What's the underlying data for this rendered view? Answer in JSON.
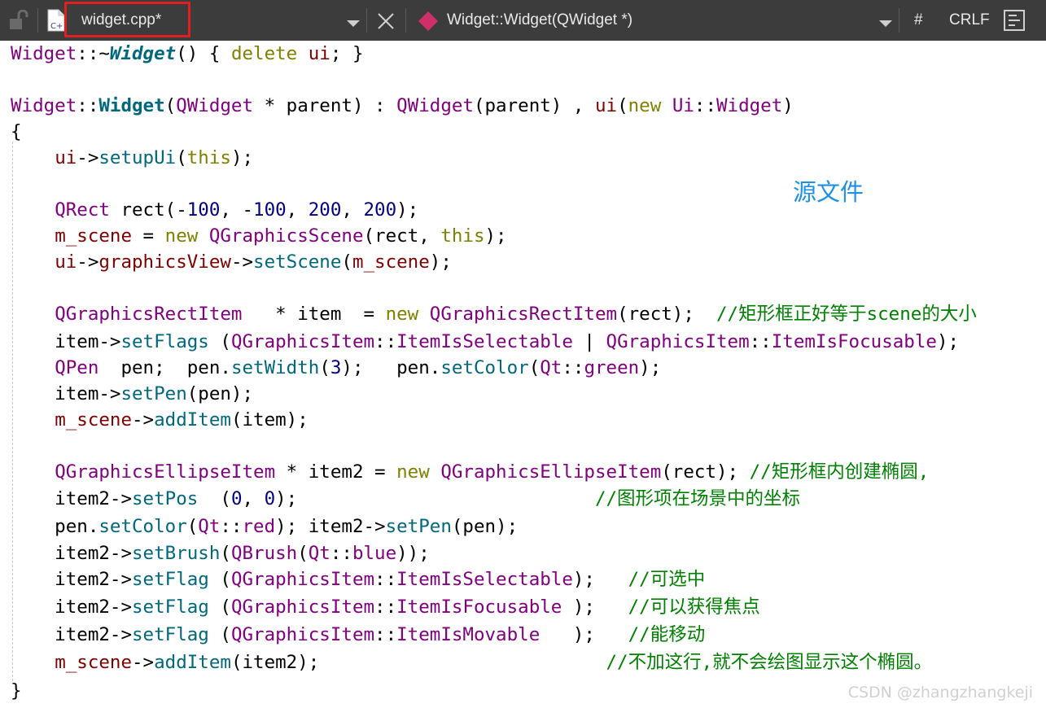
{
  "toolbar": {
    "file_tab": "widget.cpp*",
    "symbol": "Widget::Widget(QWidget *)",
    "hash": "#",
    "line_ending": "CRLF",
    "colors": {
      "background": "#3c3c3c",
      "highlight_border": "#e02020",
      "symbol_icon": "#d0306a"
    }
  },
  "code_lines": [
    [
      [
        "Widget",
        "cls"
      ],
      [
        "::~",
        "txt"
      ],
      [
        "Widget",
        "bi"
      ],
      [
        "() { ",
        "txt"
      ],
      [
        "delete",
        "kw"
      ],
      [
        " ",
        "txt"
      ],
      [
        "ui",
        "var"
      ],
      [
        "; }",
        "txt"
      ]
    ],
    [],
    [
      [
        "Widget",
        "cls"
      ],
      [
        "::",
        "txt"
      ],
      [
        "Widget",
        "b"
      ],
      [
        "(",
        "txt"
      ],
      [
        "QWidget",
        "cls"
      ],
      [
        " * ",
        "txt"
      ],
      [
        "parent",
        "txt"
      ],
      [
        ") : ",
        "txt"
      ],
      [
        "QWidget",
        "cls"
      ],
      [
        "(parent) , ",
        "txt"
      ],
      [
        "ui",
        "var"
      ],
      [
        "(",
        "txt"
      ],
      [
        "new",
        "kw"
      ],
      [
        " ",
        "txt"
      ],
      [
        "Ui",
        "cls"
      ],
      [
        "::",
        "txt"
      ],
      [
        "Widget",
        "cls"
      ],
      [
        ")",
        "txt"
      ]
    ],
    [
      [
        "{",
        "txt"
      ]
    ],
    [
      [
        "    ",
        "txt"
      ],
      [
        "ui",
        "var"
      ],
      [
        "->",
        "txt"
      ],
      [
        "setupUi",
        "fn"
      ],
      [
        "(",
        "txt"
      ],
      [
        "this",
        "kw"
      ],
      [
        ");",
        "txt"
      ]
    ],
    [],
    [
      [
        "    ",
        "txt"
      ],
      [
        "QRect",
        "cls"
      ],
      [
        " rect(-",
        "txt"
      ],
      [
        "100",
        "num"
      ],
      [
        ", -",
        "txt"
      ],
      [
        "100",
        "num"
      ],
      [
        ", ",
        "txt"
      ],
      [
        "200",
        "num"
      ],
      [
        ", ",
        "txt"
      ],
      [
        "200",
        "num"
      ],
      [
        ");",
        "txt"
      ]
    ],
    [
      [
        "    ",
        "txt"
      ],
      [
        "m_scene",
        "var"
      ],
      [
        " = ",
        "txt"
      ],
      [
        "new",
        "kw"
      ],
      [
        " ",
        "txt"
      ],
      [
        "QGraphicsScene",
        "cls"
      ],
      [
        "(rect, ",
        "txt"
      ],
      [
        "this",
        "kw"
      ],
      [
        ");",
        "txt"
      ]
    ],
    [
      [
        "    ",
        "txt"
      ],
      [
        "ui",
        "var"
      ],
      [
        "->",
        "txt"
      ],
      [
        "graphicsView",
        "var"
      ],
      [
        "->",
        "txt"
      ],
      [
        "setScene",
        "fn"
      ],
      [
        "(",
        "txt"
      ],
      [
        "m_scene",
        "var"
      ],
      [
        ");",
        "txt"
      ]
    ],
    [],
    [
      [
        "    ",
        "txt"
      ],
      [
        "QGraphicsRectItem",
        "cls"
      ],
      [
        "   * item  = ",
        "txt"
      ],
      [
        "new",
        "kw"
      ],
      [
        " ",
        "txt"
      ],
      [
        "QGraphicsRectItem",
        "cls"
      ],
      [
        "(rect);  ",
        "txt"
      ],
      [
        "//矩形框正好等于scene的大小",
        "cmt"
      ]
    ],
    [
      [
        "    item->",
        "txt"
      ],
      [
        "setFlags",
        "fn"
      ],
      [
        " (",
        "txt"
      ],
      [
        "QGraphicsItem",
        "cls"
      ],
      [
        "::",
        "txt"
      ],
      [
        "ItemIsSelectable",
        "cls"
      ],
      [
        " | ",
        "txt"
      ],
      [
        "QGraphicsItem",
        "cls"
      ],
      [
        "::",
        "txt"
      ],
      [
        "ItemIsFocusable",
        "cls"
      ],
      [
        ");",
        "txt"
      ]
    ],
    [
      [
        "    ",
        "txt"
      ],
      [
        "QPen",
        "cls"
      ],
      [
        "  pen;  pen.",
        "txt"
      ],
      [
        "setWidth",
        "fn"
      ],
      [
        "(",
        "txt"
      ],
      [
        "3",
        "num"
      ],
      [
        ");   pen.",
        "txt"
      ],
      [
        "setColor",
        "fn"
      ],
      [
        "(",
        "txt"
      ],
      [
        "Qt",
        "cls"
      ],
      [
        "::",
        "txt"
      ],
      [
        "green",
        "cls"
      ],
      [
        ");",
        "txt"
      ]
    ],
    [
      [
        "    item->",
        "txt"
      ],
      [
        "setPen",
        "fn"
      ],
      [
        "(pen);",
        "txt"
      ]
    ],
    [
      [
        "    ",
        "txt"
      ],
      [
        "m_scene",
        "var"
      ],
      [
        "->",
        "txt"
      ],
      [
        "addItem",
        "fn"
      ],
      [
        "(item);",
        "txt"
      ]
    ],
    [],
    [
      [
        "    ",
        "txt"
      ],
      [
        "QGraphicsEllipseItem",
        "cls"
      ],
      [
        " * item2 = ",
        "txt"
      ],
      [
        "new",
        "kw"
      ],
      [
        " ",
        "txt"
      ],
      [
        "QGraphicsEllipseItem",
        "cls"
      ],
      [
        "(rect); ",
        "txt"
      ],
      [
        "//矩形框内创建椭圆,",
        "cmt"
      ]
    ],
    [
      [
        "    item2->",
        "txt"
      ],
      [
        "setPos",
        "fn"
      ],
      [
        "  (",
        "txt"
      ],
      [
        "0",
        "num"
      ],
      [
        ", ",
        "txt"
      ],
      [
        "0",
        "num"
      ],
      [
        ");                           ",
        "txt"
      ],
      [
        "//图形项在场景中的坐标",
        "cmt"
      ]
    ],
    [
      [
        "    pen.",
        "txt"
      ],
      [
        "setColor",
        "fn"
      ],
      [
        "(",
        "txt"
      ],
      [
        "Qt",
        "cls"
      ],
      [
        "::",
        "txt"
      ],
      [
        "red",
        "cls"
      ],
      [
        "); item2->",
        "txt"
      ],
      [
        "setPen",
        "fn"
      ],
      [
        "(pen);",
        "txt"
      ]
    ],
    [
      [
        "    item2->",
        "txt"
      ],
      [
        "setBrush",
        "fn"
      ],
      [
        "(",
        "txt"
      ],
      [
        "QBrush",
        "cls"
      ],
      [
        "(",
        "txt"
      ],
      [
        "Qt",
        "cls"
      ],
      [
        "::",
        "txt"
      ],
      [
        "blue",
        "cls"
      ],
      [
        "));",
        "txt"
      ]
    ],
    [
      [
        "    item2->",
        "txt"
      ],
      [
        "setFlag",
        "fn"
      ],
      [
        " (",
        "txt"
      ],
      [
        "QGraphicsItem",
        "cls"
      ],
      [
        "::",
        "txt"
      ],
      [
        "ItemIsSelectable",
        "cls"
      ],
      [
        ");   ",
        "txt"
      ],
      [
        "//可选中",
        "cmt"
      ]
    ],
    [
      [
        "    item2->",
        "txt"
      ],
      [
        "setFlag",
        "fn"
      ],
      [
        " (",
        "txt"
      ],
      [
        "QGraphicsItem",
        "cls"
      ],
      [
        "::",
        "txt"
      ],
      [
        "ItemIsFocusable",
        "cls"
      ],
      [
        " );   ",
        "txt"
      ],
      [
        "//可以获得焦点",
        "cmt"
      ]
    ],
    [
      [
        "    item2->",
        "txt"
      ],
      [
        "setFlag",
        "fn"
      ],
      [
        " (",
        "txt"
      ],
      [
        "QGraphicsItem",
        "cls"
      ],
      [
        "::",
        "txt"
      ],
      [
        "ItemIsMovable",
        "cls"
      ],
      [
        "   );   ",
        "txt"
      ],
      [
        "//能移动",
        "cmt"
      ]
    ],
    [
      [
        "    ",
        "txt"
      ],
      [
        "m_scene",
        "var"
      ],
      [
        "->",
        "txt"
      ],
      [
        "addItem",
        "fn"
      ],
      [
        "(item2);                          ",
        "txt"
      ],
      [
        "//不加这行,就不会绘图显示这个椭圆。",
        "cmt"
      ]
    ],
    [
      [
        "}",
        "txt"
      ]
    ]
  ],
  "annotation": "源文件",
  "watermark": "CSDN @zhangzhangkeji"
}
